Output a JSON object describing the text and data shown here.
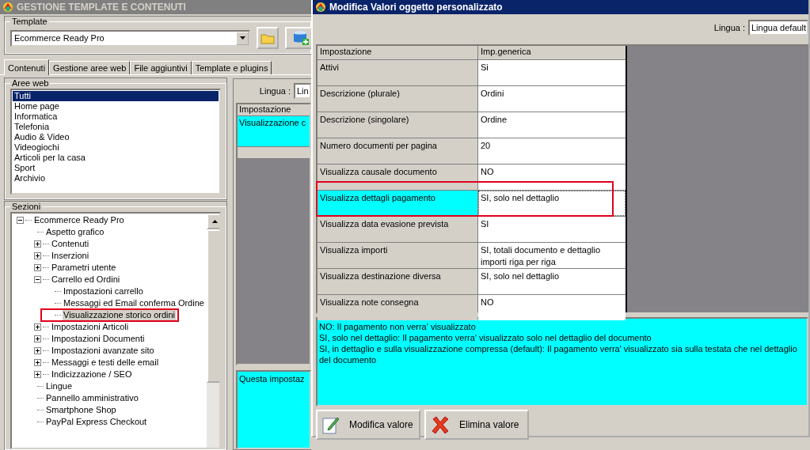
{
  "main_window": {
    "title": "GESTIONE TEMPLATE E CONTENUTI",
    "template": {
      "label": "Template",
      "value": "Ecommerce Ready Pro"
    },
    "tabs": [
      {
        "label": "Contenuti",
        "selected": true
      },
      {
        "label": "Gestione aree web",
        "selected": false
      },
      {
        "label": "File aggiuntivi",
        "selected": false
      },
      {
        "label": "Template e plugins",
        "selected": false
      }
    ],
    "aree_web": {
      "label": "Aree web",
      "items": [
        {
          "label": "Tutti",
          "selected": true
        },
        {
          "label": "Home page",
          "selected": false
        },
        {
          "label": "Informatica",
          "selected": false
        },
        {
          "label": "Telefonia",
          "selected": false
        },
        {
          "label": "Audio & Video",
          "selected": false
        },
        {
          "label": "Videogiochi",
          "selected": false
        },
        {
          "label": "Articoli per la casa",
          "selected": false
        },
        {
          "label": "Sport",
          "selected": false
        },
        {
          "label": "Archivio",
          "selected": false
        }
      ]
    },
    "sezioni": {
      "label": "Sezioni",
      "tree": [
        {
          "label": "Ecommerce Ready Pro",
          "expanded": true,
          "selected": false,
          "children": [
            {
              "label": "Aspetto grafico",
              "selected": false
            },
            {
              "label": "Contenuti",
              "expanded": false,
              "selected": false
            },
            {
              "label": "Inserzioni",
              "expanded": false,
              "selected": false
            },
            {
              "label": "Parametri utente",
              "expanded": false,
              "selected": false
            },
            {
              "label": "Carrello ed Ordini",
              "expanded": true,
              "selected": false,
              "children": [
                {
                  "label": "Impostazioni carrello",
                  "selected": false
                },
                {
                  "label": "Messaggi ed Email conferma Ordine",
                  "selected": false
                },
                {
                  "label": "Visualizzazione storico ordini",
                  "selected": true,
                  "highlighted": true
                }
              ]
            },
            {
              "label": "Impostazioni Articoli",
              "expanded": false,
              "selected": false
            },
            {
              "label": "Impostazioni Documenti",
              "expanded": false,
              "selected": false
            },
            {
              "label": "Impostazioni avanzate sito",
              "expanded": false,
              "selected": false
            },
            {
              "label": "Messaggi e testi delle email",
              "expanded": false,
              "selected": false
            },
            {
              "label": "Indicizzazione / SEO",
              "expanded": false,
              "selected": false
            },
            {
              "label": "Lingue",
              "selected": false
            },
            {
              "label": "Pannello amministrativo",
              "selected": false
            },
            {
              "label": "Smartphone Shop",
              "selected": false
            },
            {
              "label": "PayPal Express Checkout",
              "selected": false
            }
          ]
        }
      ]
    },
    "right_panel": {
      "lingua_label": "Lingua :",
      "lingua_value": "Lin",
      "column": "Impostazione",
      "row": "Visualizzazione c",
      "description": "Questa impostaz"
    }
  },
  "dialog": {
    "title": "Modifica Valori oggetto personalizzato",
    "lingua_label": "Lingua :",
    "lingua_value": "Lingua default",
    "columns": [
      "Impostazione",
      "Imp.generica"
    ],
    "rows": [
      {
        "setting": "Attivi",
        "value": "Si",
        "selected": false
      },
      {
        "setting": "Descrizione (plurale)",
        "value": "Ordini",
        "selected": false
      },
      {
        "setting": "Descrizione (singolare)",
        "value": "Ordine",
        "selected": false
      },
      {
        "setting": "Numero documenti per pagina",
        "value": "20",
        "selected": false
      },
      {
        "setting": "Visualizza causale documento",
        "value": "NO",
        "selected": false
      },
      {
        "setting": "Visualizza dettagli pagamento",
        "value": "SI, solo nel dettaglio",
        "selected": true,
        "highlighted": true
      },
      {
        "setting": "Visualizza data evasione prevista",
        "value": "SI",
        "selected": false
      },
      {
        "setting": "Visualizza importi",
        "value": "SI, totali documento e dettaglio importi riga per riga",
        "selected": false
      },
      {
        "setting": "Visualizza destinazione diversa",
        "value": "SI, solo nel dettaglio",
        "selected": false
      },
      {
        "setting": "Visualizza note consegna",
        "value": "NO",
        "selected": false
      }
    ],
    "description": [
      "NO: Il pagamento non verra' visualizzato",
      "SI, solo nel dettaglio: Il pagamento verra' visualizzato solo nel dettaglio del documento",
      "SI, in dettaglio e sulla visualizzazione compressa  (default): Il pagamento verra' visualizzato sia sulla testata che nel dettaglio del documento"
    ],
    "buttons": [
      {
        "label": "Modifica valore",
        "kind": "edit"
      },
      {
        "label": "Elimina valore",
        "kind": "delete"
      }
    ]
  }
}
